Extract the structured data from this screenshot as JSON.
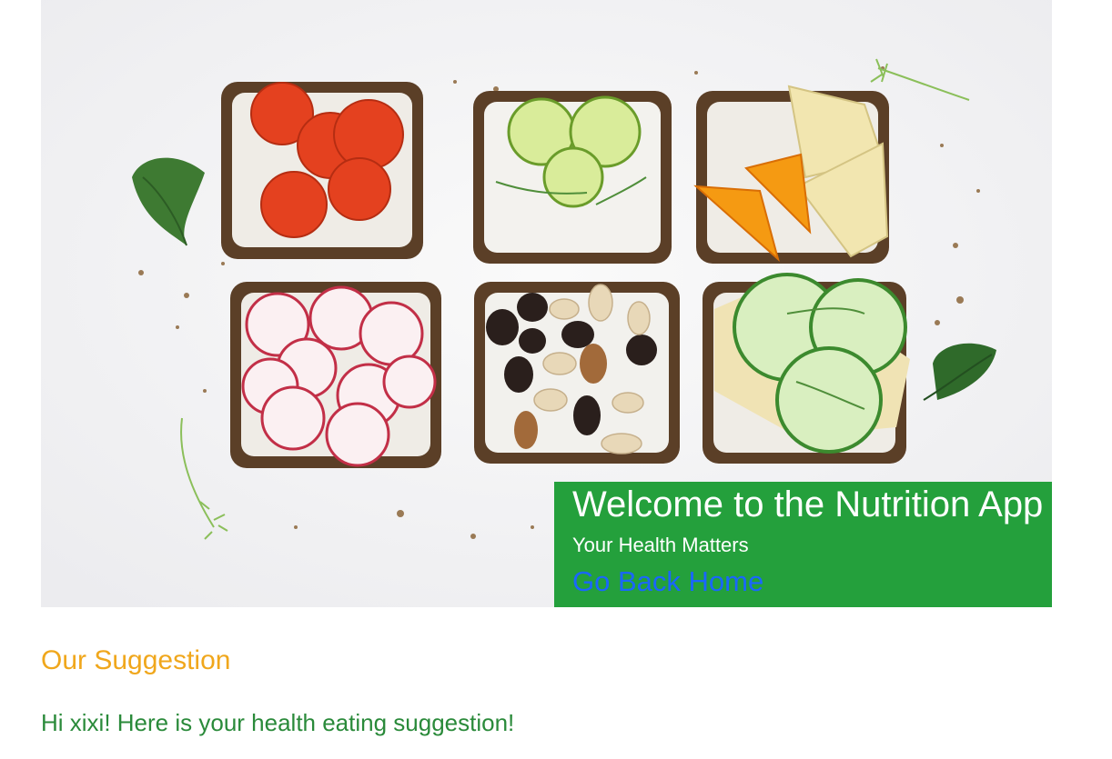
{
  "hero": {
    "image_alt": "Six slices of rye toast with cream cheese and toppings: tomato, lime, orange and cheese, radish, nuts and raisins, cucumber",
    "title": "Welcome to the Nutrition App",
    "subtitle": "Your Health Matters",
    "home_link": "Go Back Home"
  },
  "suggestion": {
    "heading": "Our Suggestion",
    "greeting": "Hi xixi! Here is your health eating suggestion!"
  },
  "colors": {
    "banner_bg": "#24a03c",
    "link": "#1a66ff",
    "heading": "#f0a71c",
    "greeting": "#2a8a3a"
  }
}
